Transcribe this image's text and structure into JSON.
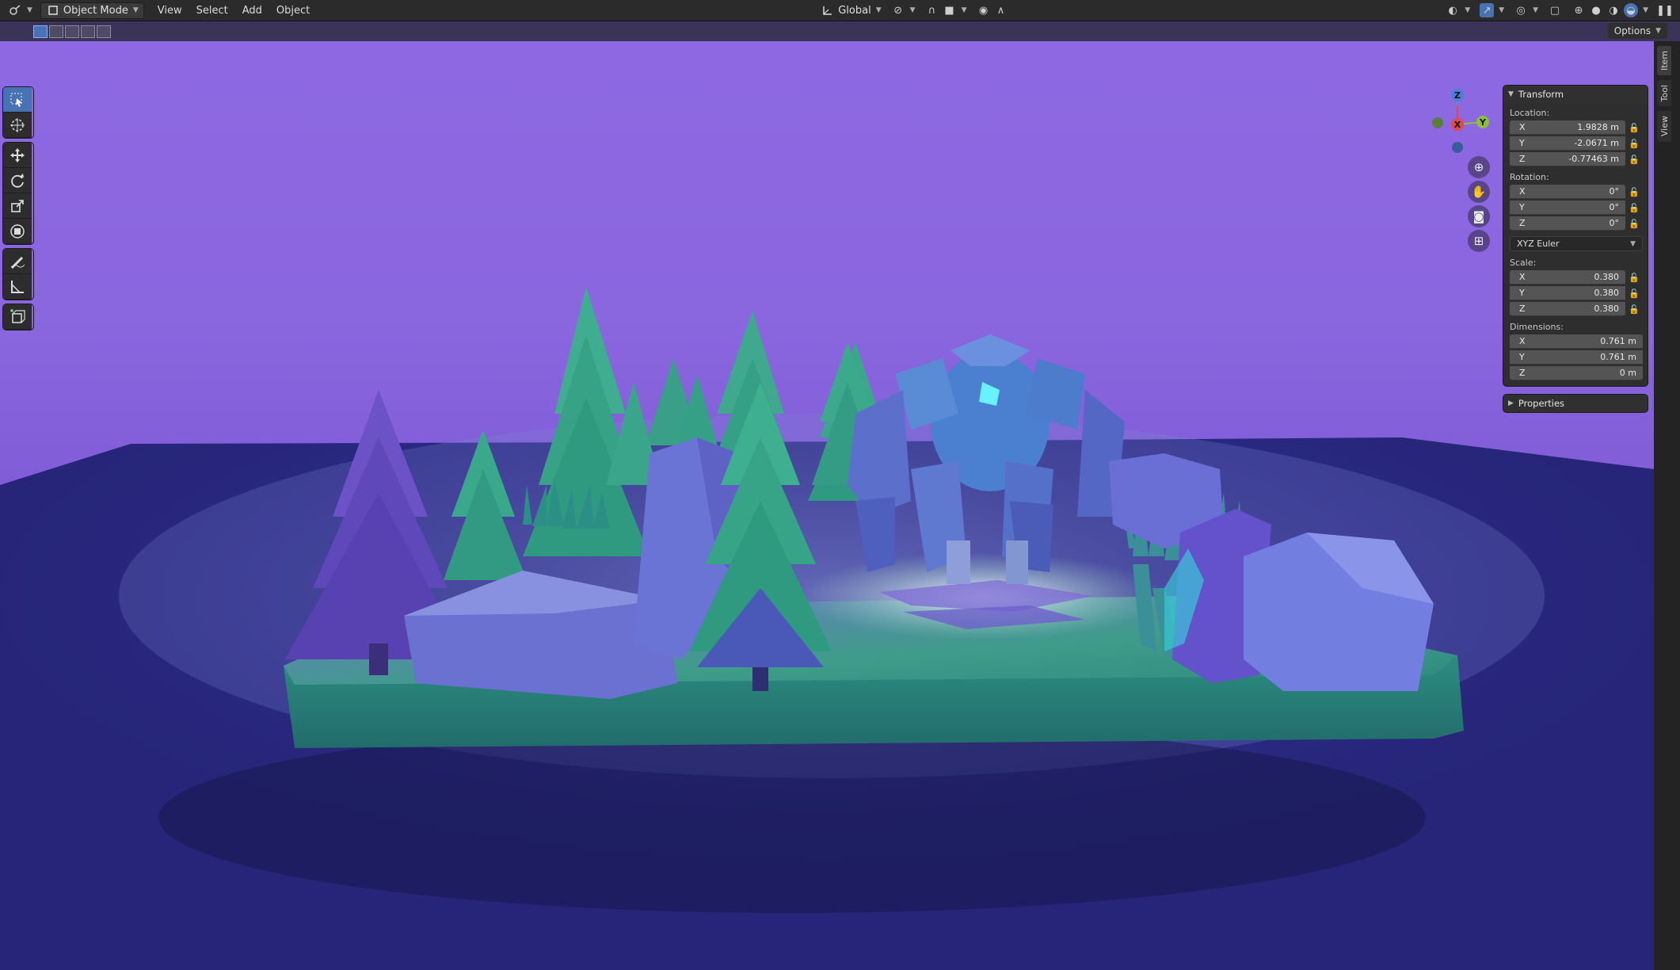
{
  "header": {
    "editor_type_icon": "editor-type-icon",
    "mode": "Object Mode",
    "menus": [
      "View",
      "Select",
      "Add",
      "Object"
    ],
    "orientation": "Global"
  },
  "subheader": {
    "options_label": "Options"
  },
  "toolbar": {
    "tools": [
      "select-box",
      "cursor",
      "move",
      "rotate",
      "scale",
      "transform",
      "annotate",
      "measure",
      "add-cube"
    ]
  },
  "gizmo": {
    "z": "Z",
    "x": "X",
    "y": "Y"
  },
  "transform": {
    "title": "Transform",
    "location_label": "Location:",
    "location": [
      {
        "axis": "X",
        "value": "1.9828 m"
      },
      {
        "axis": "Y",
        "value": "-2.0671 m"
      },
      {
        "axis": "Z",
        "value": "-0.77463 m"
      }
    ],
    "rotation_label": "Rotation:",
    "rotation": [
      {
        "axis": "X",
        "value": "0°"
      },
      {
        "axis": "Y",
        "value": "0°"
      },
      {
        "axis": "Z",
        "value": "0°"
      }
    ],
    "rotation_mode": "XYZ Euler",
    "scale_label": "Scale:",
    "scale": [
      {
        "axis": "X",
        "value": "0.380"
      },
      {
        "axis": "Y",
        "value": "0.380"
      },
      {
        "axis": "Z",
        "value": "0.380"
      }
    ],
    "dimensions_label": "Dimensions:",
    "dimensions": [
      {
        "axis": "X",
        "value": "0.761 m"
      },
      {
        "axis": "Y",
        "value": "0.761 m"
      },
      {
        "axis": "Z",
        "value": "0 m"
      }
    ]
  },
  "properties": {
    "title": "Properties"
  },
  "side_tabs": [
    "Item",
    "Tool",
    "View"
  ],
  "colors": {
    "sky": "#8d68e2",
    "floor": "#222279",
    "grass": "#2f9a86",
    "trees": "#2fa98a",
    "rocks": "#6a6fd6",
    "golem": "#4b7fcf",
    "glow": "#5ff0ff",
    "active_tool": "#4772b3"
  }
}
